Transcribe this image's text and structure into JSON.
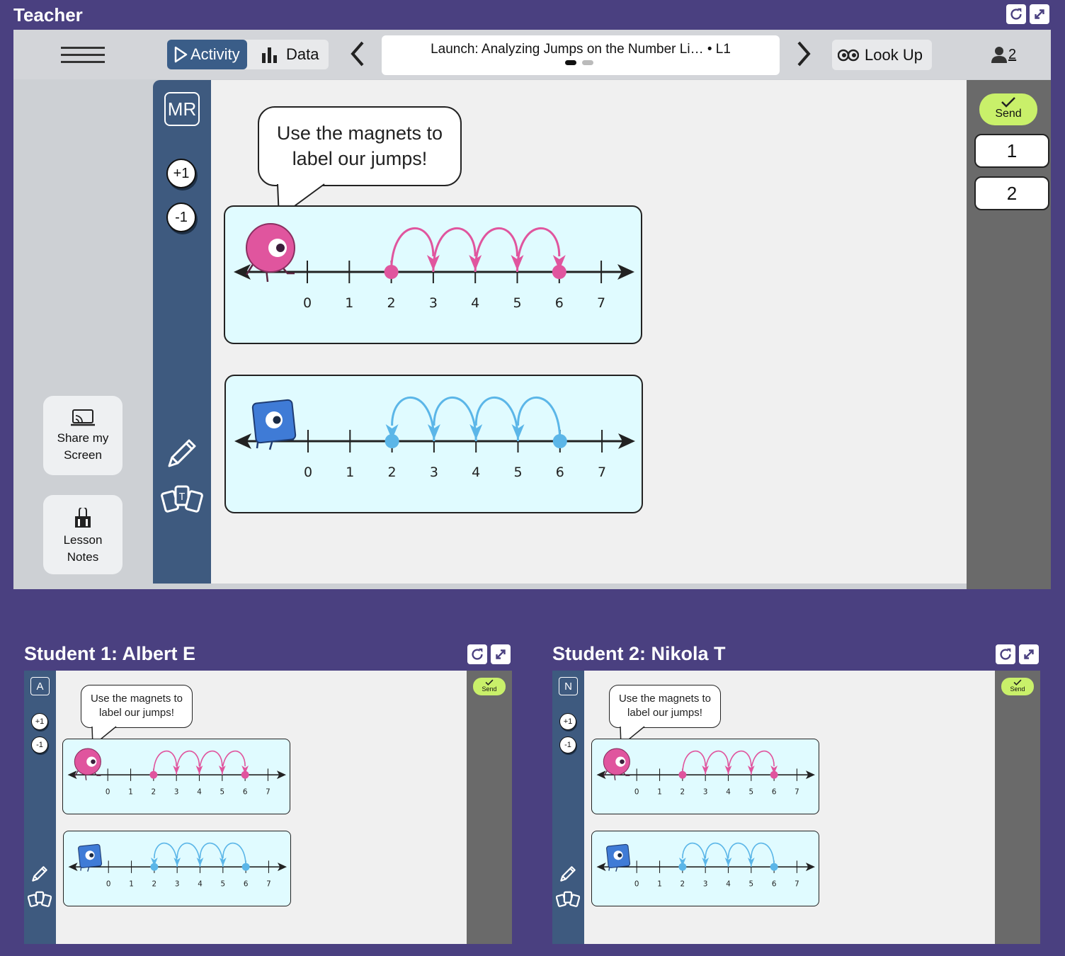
{
  "teacher": {
    "pane_title": "Teacher",
    "tabs": {
      "activity": "Activity",
      "data": "Data"
    },
    "screen_title": "Launch: Analyzing Jumps on the Number Li… • L1",
    "look_up": "Look Up",
    "user_count": "2",
    "initials": "MR",
    "plus_one": "+1",
    "minus_one": "-1",
    "share_screen": "Share my Screen",
    "lesson_notes": "Lesson Notes",
    "send": "Send",
    "pages": [
      "1",
      "2"
    ],
    "speech": "Use the magnets to label our jumps!"
  },
  "students": [
    {
      "title": "Student 1: Albert E",
      "initial": "A",
      "send": "Send",
      "speech": "Use the magnets to label our jumps!",
      "plus_one": "+1",
      "minus_one": "-1"
    },
    {
      "title": "Student 2: Nikola T",
      "initial": "N",
      "send": "Send",
      "speech": "Use the magnets to label our jumps!",
      "plus_one": "+1",
      "minus_one": "-1"
    }
  ],
  "number_lines": {
    "ticks": [
      "0",
      "1",
      "2",
      "3",
      "4",
      "5",
      "6",
      "7"
    ],
    "pink": {
      "color": "#e0559e",
      "start": 2,
      "end": 6,
      "jumps": [
        [
          2,
          3
        ],
        [
          3,
          4
        ],
        [
          4,
          5
        ],
        [
          5,
          6
        ]
      ]
    },
    "blue": {
      "color": "#5bb6e8",
      "start": 6,
      "end": 2,
      "jumps": [
        [
          3,
          2
        ],
        [
          4,
          3
        ],
        [
          5,
          4
        ],
        [
          6,
          5
        ]
      ]
    }
  },
  "colors": {
    "background": "#4a4080",
    "toolbar": "#3e5a7f",
    "send": "#c9f06a",
    "numberline_bg": "#e0fbff"
  }
}
